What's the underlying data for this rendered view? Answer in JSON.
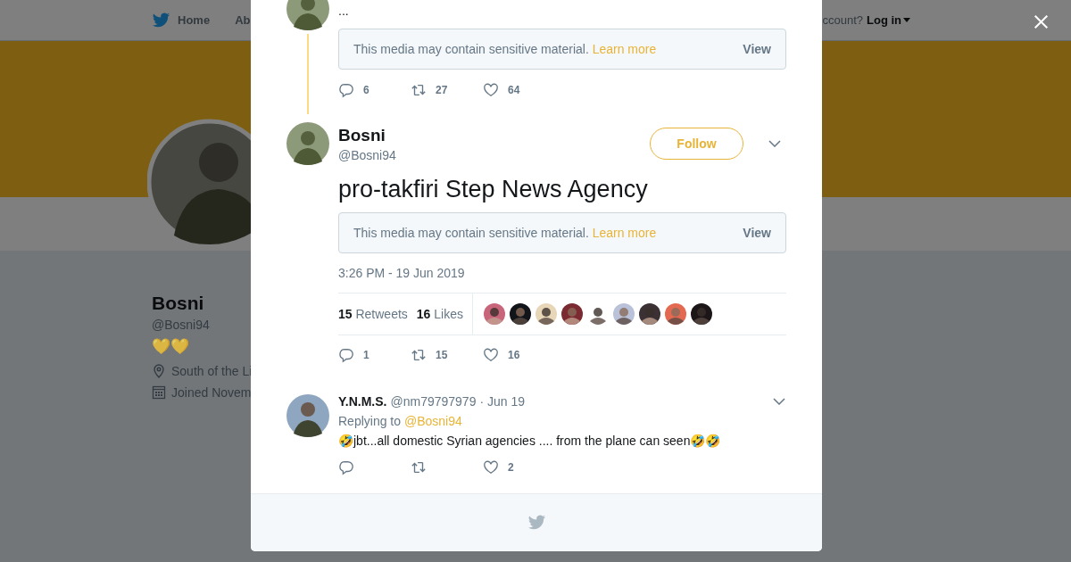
{
  "nav": {
    "items": [
      "Home",
      "Ab"
    ],
    "account_prompt": "ccount?",
    "login": "Log in"
  },
  "profile": {
    "name": "Bosni",
    "handle": "@Bosni94",
    "bio": "💛💛",
    "location": "South of the Li",
    "joined": "Joined Novem"
  },
  "modal": {
    "parent_tweet": {
      "text": "...",
      "media_notice": {
        "text": "This media may contain sensitive material.",
        "link": "Learn more",
        "button": "View"
      },
      "replies": "6",
      "retweets": "27",
      "likes": "64"
    },
    "tweet": {
      "name": "Bosni",
      "handle": "@Bosni94",
      "follow": "Follow",
      "text": "pro-takfiri Step News Agency",
      "media_notice": {
        "text": "This media may contain sensitive material.",
        "link": "Learn more",
        "button": "View"
      },
      "time": "3:26 PM - 19 Jun 2019",
      "retweet_count": "15",
      "retweet_label": "Retweets",
      "like_count": "16",
      "like_label": "Likes",
      "replies": "1",
      "retweets": "15",
      "likes": "16"
    },
    "reply": {
      "name": "Y.N.M.S.",
      "handle": "@nm79797979",
      "date": "· Jun 19",
      "replying_label": "Replying to",
      "replying_to": "@Bosni94",
      "text": "🤣jbt...all domestic Syrian agencies .... from the plane can seen🤣🤣",
      "likes": "2"
    }
  }
}
